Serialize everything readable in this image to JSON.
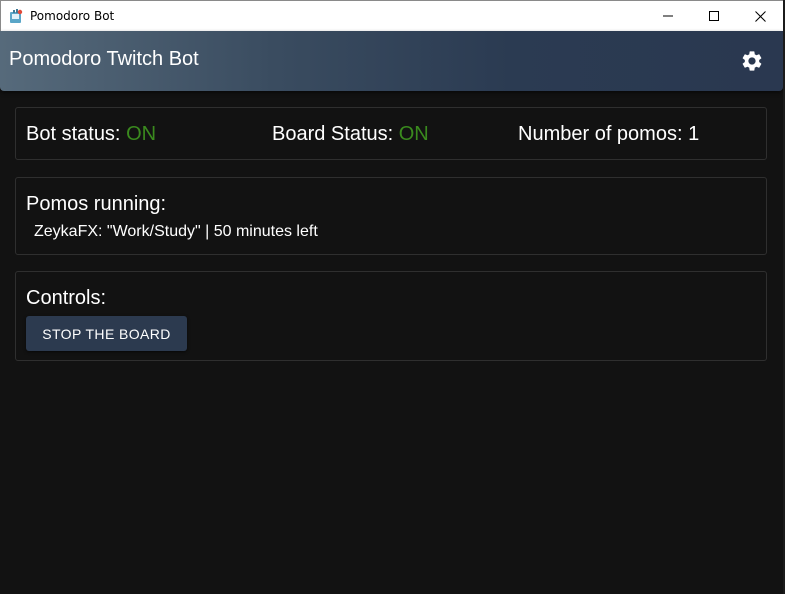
{
  "window": {
    "title": "Pomodoro Bot",
    "icon": "app-icon"
  },
  "appbar": {
    "title": "Pomodoro Twitch Bot",
    "settings_icon": "gear-icon"
  },
  "status": {
    "bot_label": "Bot status: ",
    "bot_value": "ON",
    "board_label": "Board Status: ",
    "board_value": "ON",
    "pomos_label": "Number of pomos: ",
    "pomos_value": "1"
  },
  "pomos": {
    "heading": "Pomos running:",
    "items": [
      "ZeykaFX: \"Work/Study\" | 50 minutes left"
    ]
  },
  "controls": {
    "heading": "Controls:",
    "stop_label": "STOP THE BOARD"
  },
  "colors": {
    "status_on": "#3a8a1e",
    "accent": "#2c3a4f"
  }
}
